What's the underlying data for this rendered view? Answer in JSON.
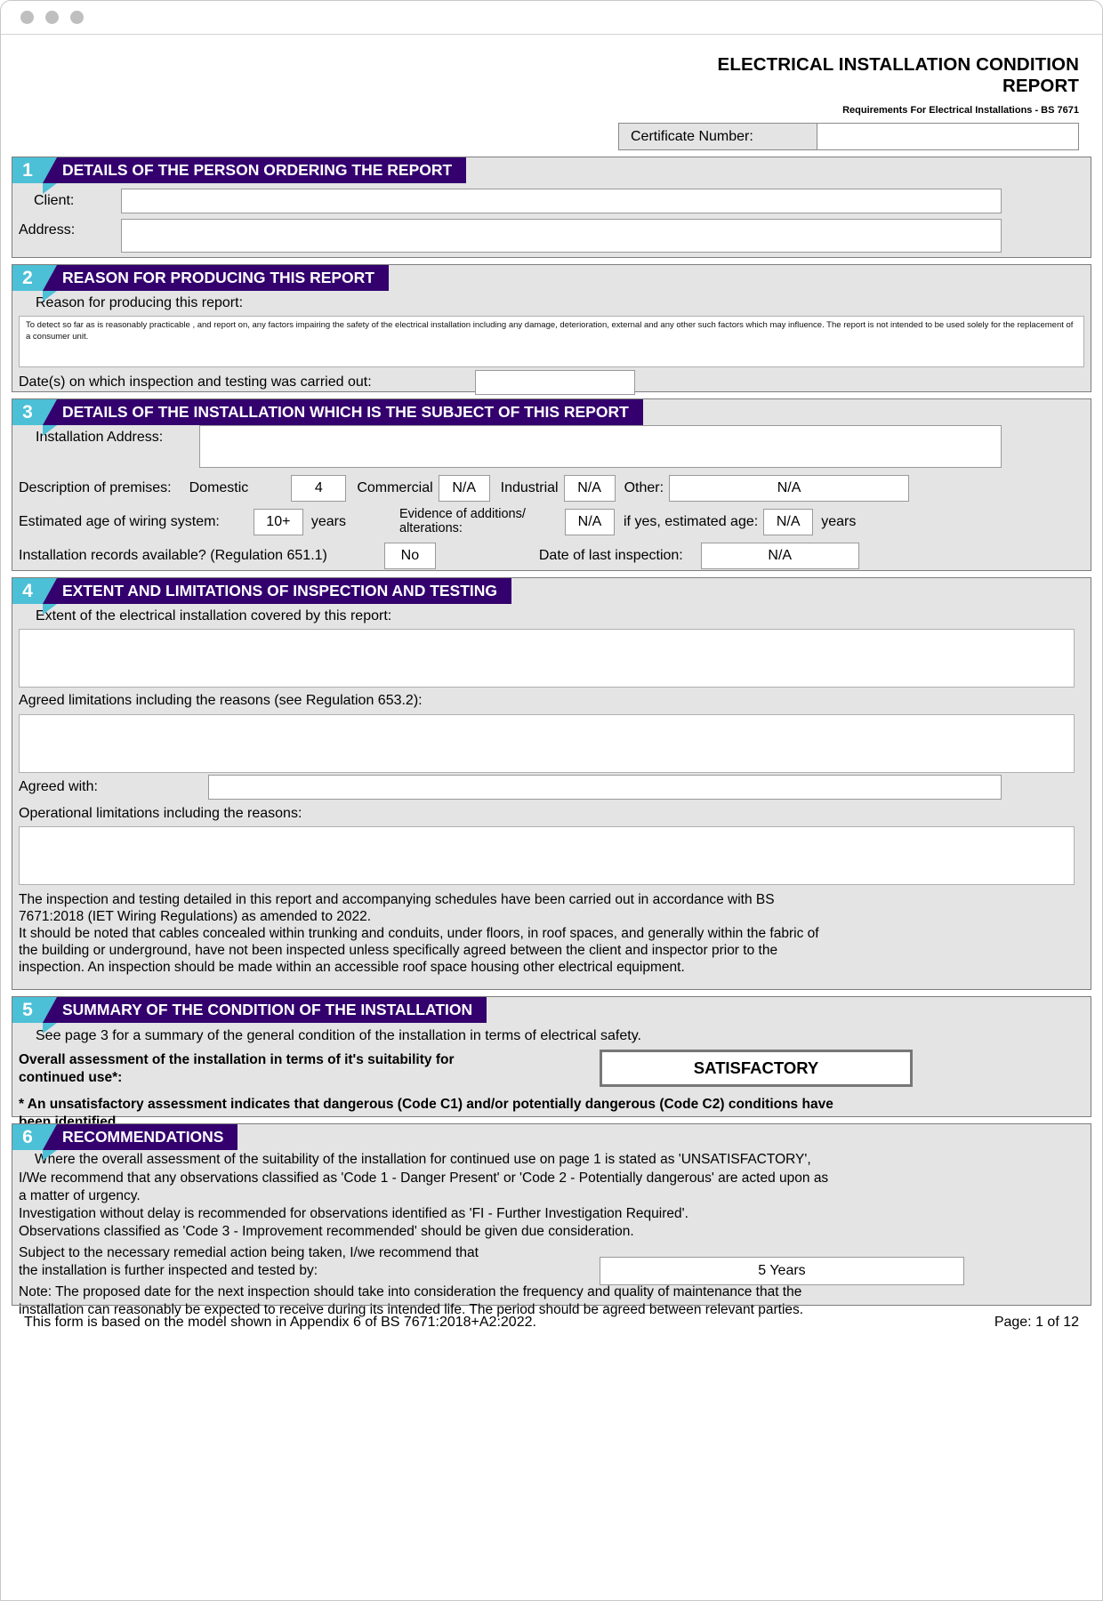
{
  "window": {
    "dots": 3
  },
  "header": {
    "title_line1": "ELECTRICAL INSTALLATION CONDITION",
    "title_line2": "REPORT",
    "subtitle": "Requirements For Electrical Installations - BS 7671",
    "certificate_label": "Certificate Number:",
    "certificate_value": ""
  },
  "section1": {
    "number": "1",
    "title": "DETAILS OF THE PERSON ORDERING THE REPORT",
    "client_label": "Client:",
    "client_value": "",
    "address_label": "Address:",
    "address_value": ""
  },
  "section2": {
    "number": "2",
    "title": "REASON FOR PRODUCING THIS REPORT",
    "reason_label": "Reason for producing this report:",
    "reason_text": "To detect so far as is reasonably practicable , and report on, any factors impairing the safety of the electrical installation including any damage, deterioration, external and any other such factors which may influence. The report is not intended to be used solely for the replacement of a consumer unit.",
    "dates_label": "Date(s) on which inspection and testing was carried out:",
    "dates_value": ""
  },
  "section3": {
    "number": "3",
    "title": "DETAILS OF THE INSTALLATION WHICH IS THE SUBJECT OF THIS REPORT",
    "install_address_label": "Installation Address:",
    "install_address_value": "",
    "description_label": "Description of premises:",
    "domestic_label": "Domestic",
    "domestic_value": "4",
    "commercial_label": "Commercial",
    "commercial_value": "N/A",
    "industrial_label": "Industrial",
    "industrial_value": "N/A",
    "other_label": "Other:",
    "other_value": "N/A",
    "age_label": "Estimated age of wiring system:",
    "age_value": "10+",
    "years_label": "years",
    "evidence_label": "Evidence of additions/ alterations:",
    "evidence_value": "N/A",
    "ifyes_label": "if yes, estimated age:",
    "ifyes_value": "N/A",
    "ifyes_years_label": "years",
    "records_label": "Installation records available? (Regulation 651.1)",
    "records_value": "No",
    "lastinsp_label": "Date of last inspection:",
    "lastinsp_value": "N/A"
  },
  "section4": {
    "number": "4",
    "title": "EXTENT AND LIMITATIONS OF INSPECTION AND TESTING",
    "extent_label": "Extent of the electrical installation covered by this report:",
    "extent_value": "",
    "agreed_limits_label": "Agreed limitations including the reasons (see Regulation 653.2):",
    "agreed_limits_value": "",
    "agreed_with_label": "Agreed with:",
    "agreed_with_value": "",
    "operational_label": "Operational limitations including the reasons:",
    "operational_value": "",
    "para_line1": "The inspection and testing detailed in this report and accompanying schedules have been carried out in accordance with BS",
    "para_line2": "7671:2018 (IET Wiring Regulations) as amended to 2022.",
    "para_line3": "It should be noted that cables concealed within trunking and conduits, under floors, in roof spaces, and generally within the fabric of",
    "para_line4": "the building or underground, have not been inspected unless specifically agreed between the client and inspector prior to the",
    "para_line5": "inspection. An inspection should be made within an accessible roof space housing other electrical equipment."
  },
  "section5": {
    "number": "5",
    "title": "SUMMARY OF THE CONDITION OF THE INSTALLATION",
    "see_page_text": "See page 3 for a summary of the general condition of the installation in terms of electrical safety.",
    "overall_label_line1": "Overall assessment of the installation in terms of it's suitability for",
    "overall_label_line2": "continued use*:",
    "assessment_value": "SATISFACTORY",
    "footnote_line1": "* An unsatisfactory assessment indicates that dangerous (Code C1) and/or potentially dangerous (Code C2) conditions have",
    "footnote_line2": "been identified."
  },
  "section6": {
    "number": "6",
    "title": "RECOMMENDATIONS",
    "rec_line1": "Where the overall assessment of the suitability of the installation for continued use on page 1 is stated as 'UNSATISFACTORY',",
    "rec_line2": "I/We recommend that any observations classified as 'Code 1 - Danger Present' or 'Code 2 - Potentially dangerous' are acted upon as",
    "rec_line3": "a matter of urgency.",
    "rec_line4": "Investigation without delay is recommended for observations identified as 'FI - Further Investigation Required'.",
    "rec_line5": "Observations classified as 'Code 3 - Improvement recommended' should be given due consideration.",
    "subject_line1": "Subject to the necessary remedial action being taken, I/we recommend that",
    "subject_line2": "the installation is further inspected and tested by:",
    "interval_value": "5 Years",
    "note_line1": "Note: The proposed date for the next inspection should take into consideration the frequency and quality of maintenance that the",
    "note_line2": "installation can reasonably be expected to receive during its intended life. The period should be agreed between relevant parties."
  },
  "footer": {
    "left": "This form is based on the model shown in Appendix 6 of BS 7671:2018+A2:2022.",
    "right": "Page: 1 of 12"
  },
  "colors": {
    "accent_cyan": "#4cc0d6",
    "accent_purple": "#33006e",
    "panel_grey": "#e4e4e4",
    "border_grey": "#7d7d7d"
  }
}
